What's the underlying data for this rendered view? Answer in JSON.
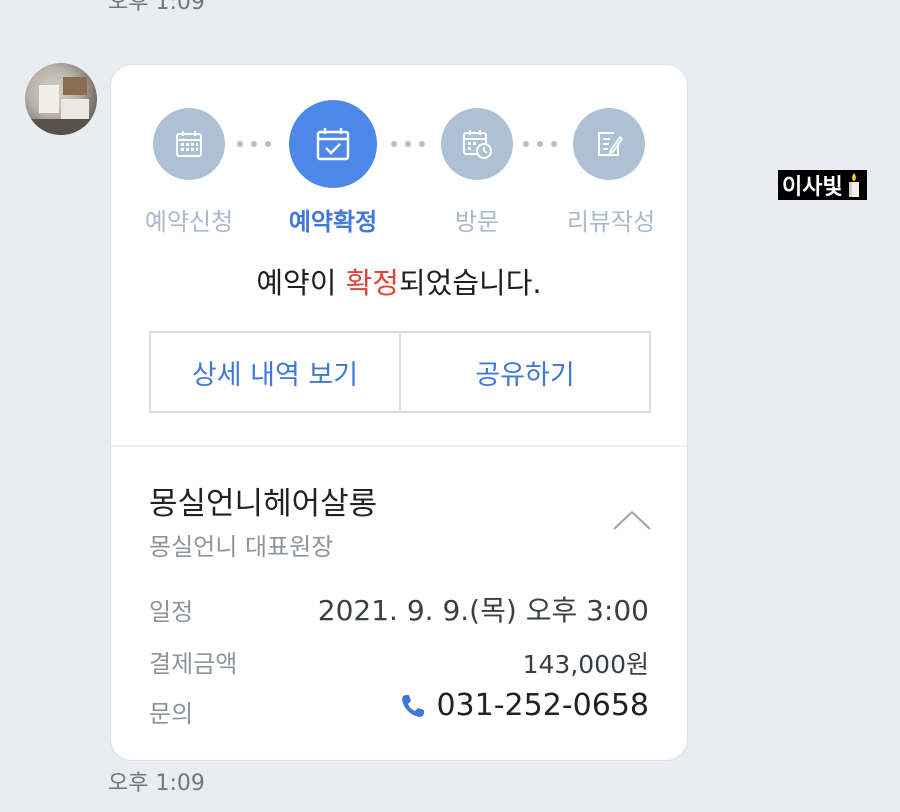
{
  "chat": {
    "top_time": "오후 1:09",
    "bottom_time": "오후 1:09"
  },
  "sticker": {
    "text": "이사빛",
    "icon": "candle-icon"
  },
  "card": {
    "steps": [
      {
        "label": "예약신청",
        "icon": "calendar-icon",
        "active": false
      },
      {
        "label": "예약확정",
        "icon": "calendar-check-icon",
        "active": true
      },
      {
        "label": "방문",
        "icon": "calendar-clock-icon",
        "active": false
      },
      {
        "label": "리뷰작성",
        "icon": "review-edit-icon",
        "active": false
      }
    ],
    "message_prefix": "예약이 ",
    "message_highlight": "확정",
    "message_suffix": "되었습니다.",
    "detail_button": "상세 내역 보기",
    "share_button": "공유하기",
    "shop_name": "몽실언니헤어살롱",
    "shop_sub": "몽실언니 대표원장",
    "rows": [
      {
        "label": "일정",
        "value": "2021. 9. 9.(목) 오후 3:00"
      },
      {
        "label": "결제금액",
        "value": "143,000원"
      },
      {
        "label": "문의",
        "value": "031-252-0658"
      }
    ]
  },
  "colors": {
    "accent": "#4d88e8",
    "highlight": "#e0453a",
    "inactive_step": "#aec0d4",
    "background": "#e9ecf0"
  }
}
